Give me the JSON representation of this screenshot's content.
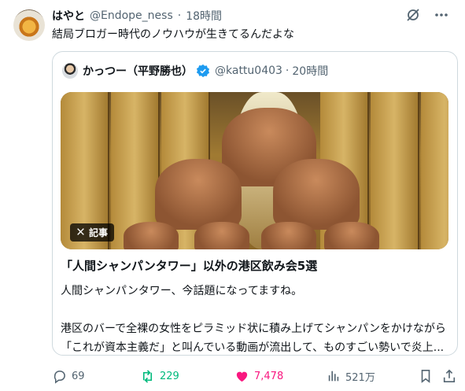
{
  "tweet": {
    "display_name": "はやと",
    "handle": "@Endope_ness",
    "separator": "·",
    "time": "18時間",
    "text": "結局ブロガー時代のノウハウが生きてるんだよな"
  },
  "quote": {
    "display_name": "かっつー（平野勝也）",
    "handle": "@kattu0403",
    "separator": "·",
    "time": "20時間",
    "image_badge": "記事",
    "title": "「人間シャンパンタワー」以外の港区飲み会5選",
    "body_line1": "人間シャンパンタワー、今話題になってますね。",
    "body_line2": "港区のバーで全裸の女性をピラミッド状に積み上げてシャンパンをかけながら",
    "body_line3": "「これが資本主義だ」と叫んでいる動画が流出して、ものすごい勢いで炎上..."
  },
  "actions": {
    "replies": "69",
    "retweets": "229",
    "likes": "7,478",
    "views": "521万"
  },
  "icons": [
    "grok-icon",
    "more-icon",
    "verified-icon",
    "x-logo-icon",
    "reply-icon",
    "retweet-icon",
    "like-icon",
    "views-icon",
    "bookmark-icon",
    "share-icon"
  ],
  "colors": {
    "retweet": "#00ba7c",
    "like": "#f91880",
    "verified": "#1d9bf0",
    "muted": "#536471"
  }
}
